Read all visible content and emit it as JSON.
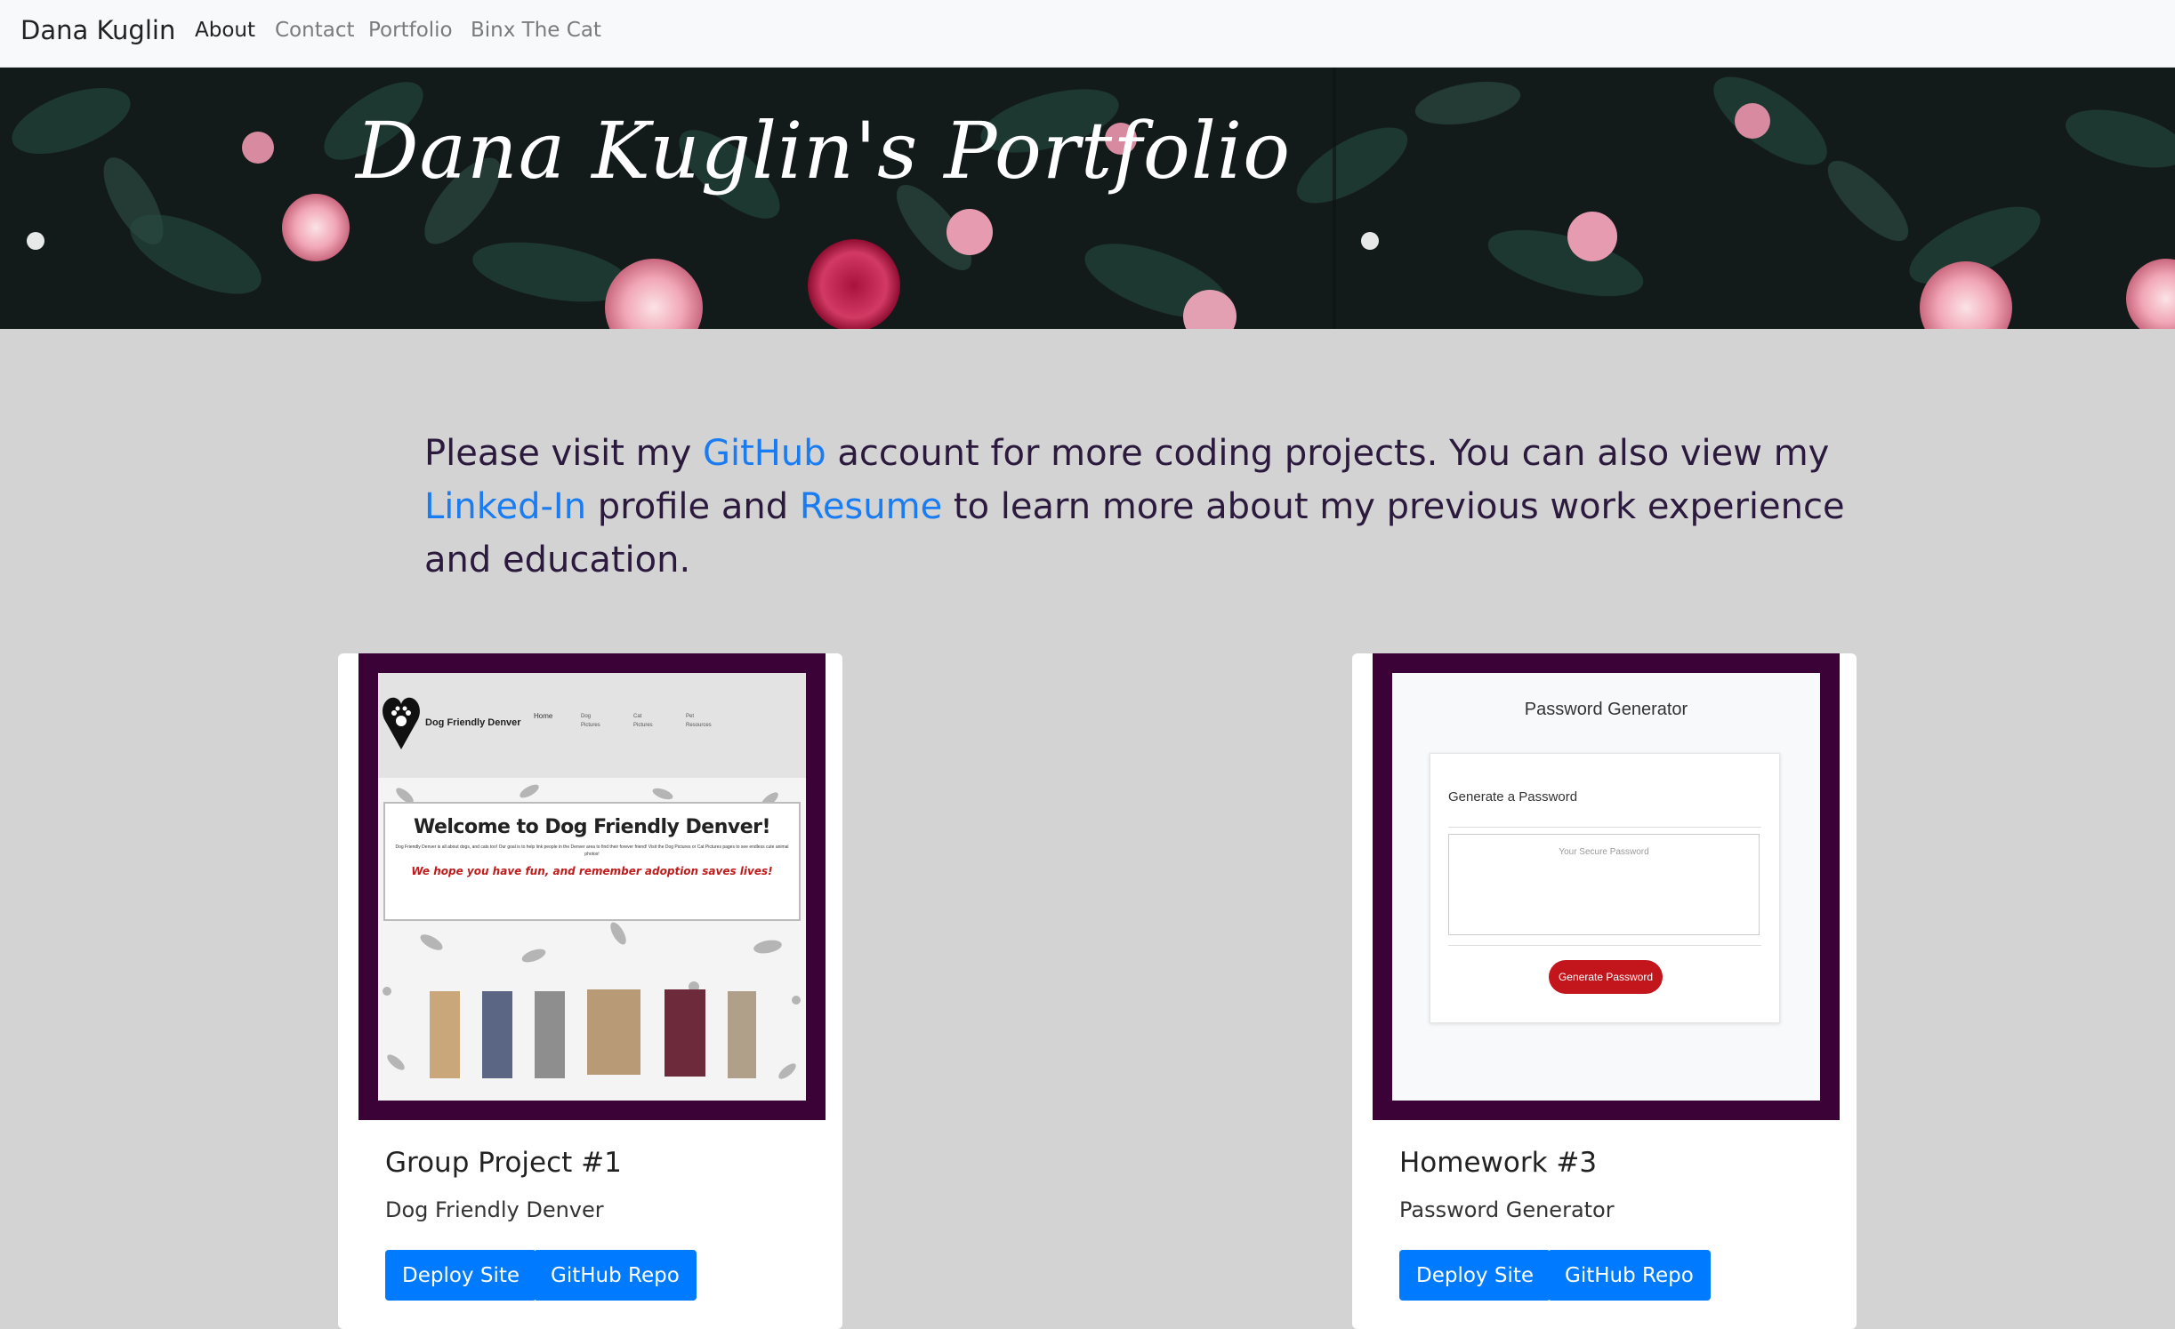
{
  "navbar": {
    "brand": "Dana Kuglin",
    "links": [
      {
        "label": "About",
        "active": true
      },
      {
        "label": "Contact",
        "active": false
      },
      {
        "label": "Portfolio",
        "active": false
      },
      {
        "label": "Binx The Cat",
        "active": false
      }
    ]
  },
  "hero": {
    "title": "Dana Kuglin's Portfolio"
  },
  "intro": {
    "part1": "Please visit my ",
    "github_link": "GitHub",
    "part2": " account for more coding projects. You can also view my ",
    "linkedin_link": "Linked-In",
    "part3": " profile and ",
    "resume_link": "Resume",
    "part4": " to learn more about my previous work experience and education."
  },
  "projects": [
    {
      "title": "Group Project #1",
      "subtitle": "Dog Friendly Denver",
      "deploy_label": "Deploy Site",
      "repo_label": "GitHub Repo",
      "screenshot": {
        "site_name": "Dog Friendly Denver",
        "nav": [
          "Home",
          "Dog Pictures",
          "Cat Pictures",
          "Pet Resources"
        ],
        "heading": "Welcome to Dog Friendly Denver!",
        "body": "Dog Friendly Denver is all about dogs, and cats too! Our goal is to help link people in the Denver area to find their forever friend! Visit the Dog Pictures or Cat Pictures pages to see endless cute animal photos!",
        "tagline": "We hope you have fun, and remember adoption saves lives!"
      }
    },
    {
      "title": "Homework #3",
      "subtitle": "Password Generator",
      "deploy_label": "Deploy Site",
      "repo_label": "GitHub Repo",
      "screenshot": {
        "heading": "Password Generator",
        "card_title": "Generate a Password",
        "placeholder": "Your Secure Password",
        "button": "Generate Password"
      }
    }
  ],
  "colors": {
    "navbar_bg": "#f8f9fa",
    "page_bg": "#d3d3d3",
    "link": "#1a7cf3",
    "button": "#007bff",
    "image_frame": "#3a0236"
  }
}
